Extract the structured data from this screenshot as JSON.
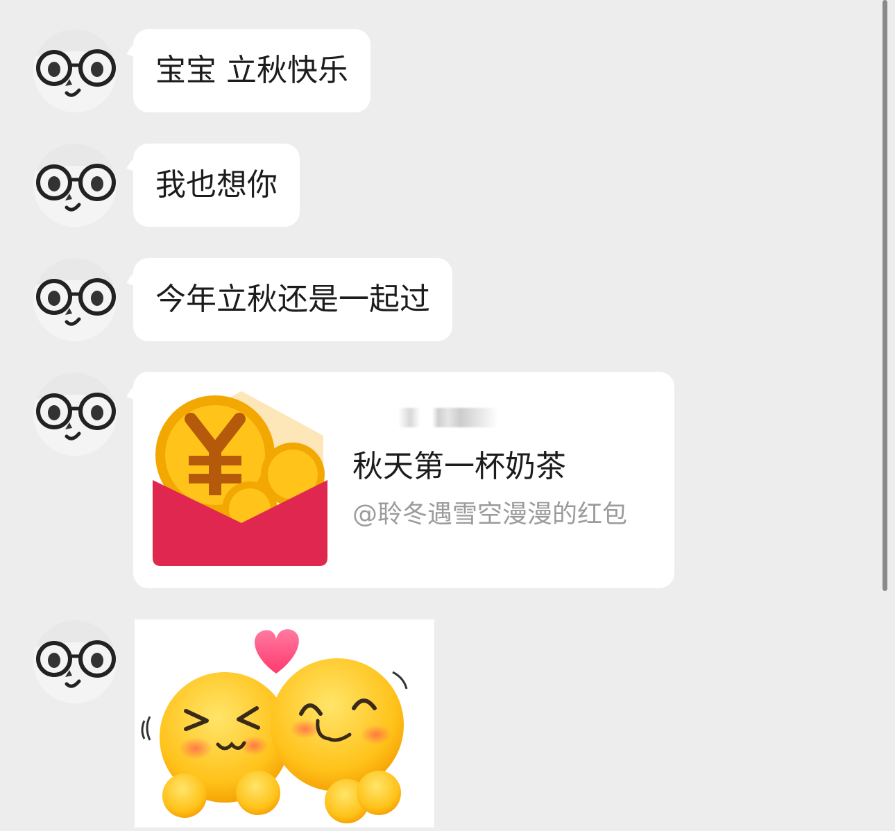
{
  "messages": [
    {
      "text": "宝宝 立秋快乐",
      "sender_avatar": "glasses-panda-avatar"
    },
    {
      "text": "我也想你",
      "sender_avatar": "glasses-panda-avatar"
    },
    {
      "text": "今年立秋还是一起过",
      "sender_avatar": "glasses-panda-avatar"
    }
  ],
  "red_packet": {
    "title": "秋天第一杯奶茶",
    "subtitle": "@聆冬遇雪空漫漫的红包",
    "icon": "red-envelope-coin-icon",
    "colors": {
      "envelope": "#e0274f",
      "coin": "#f7b400"
    }
  },
  "sticker": {
    "icon": "hugging-emoji-sticker"
  }
}
